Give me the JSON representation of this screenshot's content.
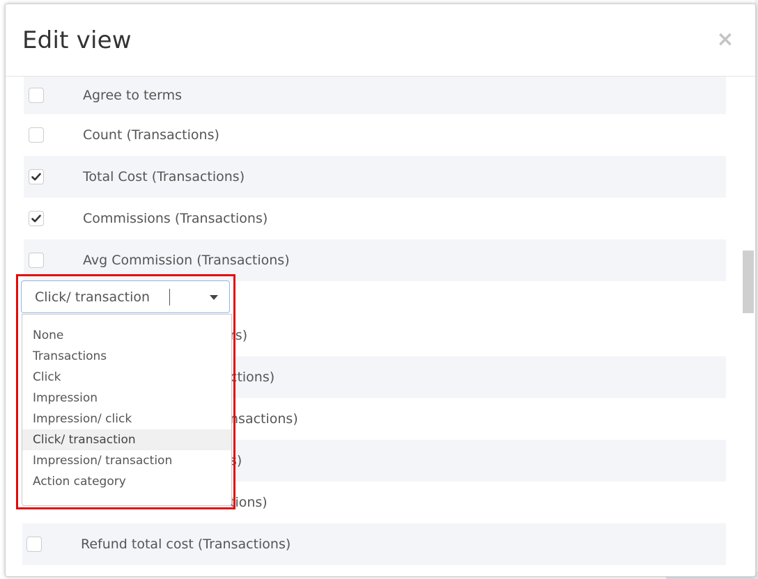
{
  "modal": {
    "title": "Edit view",
    "close_symbol": "×"
  },
  "fields": [
    {
      "label": "Agree to terms",
      "checked": false
    },
    {
      "label": "Count (Transactions)",
      "checked": false
    },
    {
      "label": "Total Cost (Transactions)",
      "checked": true
    },
    {
      "label": "Commissions (Transactions)",
      "checked": true
    },
    {
      "label": "Avg Commission (Transactions)",
      "checked": false
    },
    {
      "label": "Refund total cost (Transactions)",
      "checked": false
    }
  ],
  "partially_hidden_labels": [
    "rs)",
    "ctions)",
    "nsactions)",
    "s)",
    "tions)"
  ],
  "grouping_select": {
    "value": "Click/ transaction",
    "options": [
      "None",
      "Transactions",
      "Click",
      "Impression",
      "Impression/ click",
      "Click/ transaction",
      "Impression/ transaction",
      "Action category"
    ],
    "selected_index": 5
  },
  "icons": {
    "close": "close-icon",
    "checkmark": "checkmark-icon",
    "dropdown_arrow": "caret-down-icon"
  },
  "colors": {
    "highlight_border": "#e30a0a",
    "row_shade": "#f4f5f9",
    "select_border": "#8fb6e0"
  }
}
